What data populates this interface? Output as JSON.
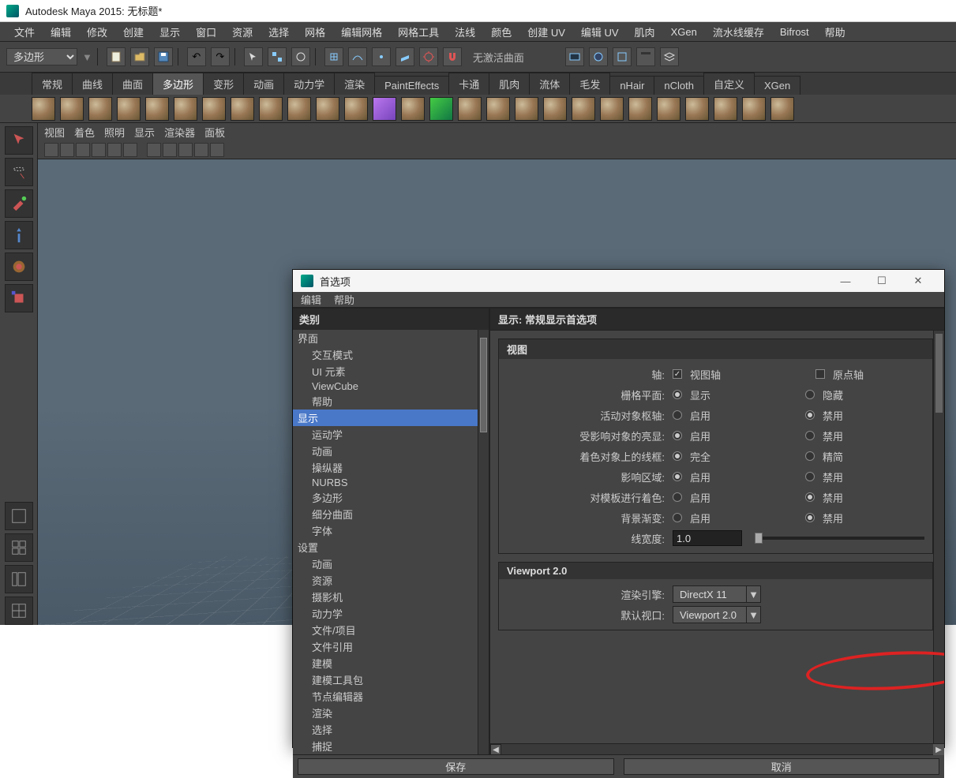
{
  "window": {
    "title": "Autodesk Maya 2015: 无标题*"
  },
  "menubar": [
    "文件",
    "编辑",
    "修改",
    "创建",
    "显示",
    "窗口",
    "资源",
    "选择",
    "网格",
    "编辑网格",
    "网格工具",
    "法线",
    "颜色",
    "创建 UV",
    "编辑 UV",
    "肌肉",
    "XGen",
    "流水线缓存",
    "Bifrost",
    "帮助"
  ],
  "mode_select": "多边形",
  "no_active_surface": "无激活曲面",
  "shelf_tabs": [
    "常规",
    "曲线",
    "曲面",
    "多边形",
    "变形",
    "动画",
    "动力学",
    "渲染",
    "PaintEffects",
    "卡通",
    "肌肉",
    "流体",
    "毛发",
    "nHair",
    "nCloth",
    "自定义",
    "XGen"
  ],
  "shelf_tab_active": 3,
  "vp_toolbar": [
    "视图",
    "着色",
    "照明",
    "显示",
    "渲染器",
    "面板"
  ],
  "dialog": {
    "title": "首选项",
    "menu": [
      "编辑",
      "帮助"
    ],
    "category_label": "类别",
    "categories": [
      {
        "txt": "界面",
        "lvl": "h"
      },
      {
        "txt": "交互模式",
        "lvl": "s"
      },
      {
        "txt": "UI 元素",
        "lvl": "s"
      },
      {
        "txt": "ViewCube",
        "lvl": "s"
      },
      {
        "txt": "帮助",
        "lvl": "s"
      },
      {
        "txt": "显示",
        "lvl": "h",
        "sel": true
      },
      {
        "txt": "运动学",
        "lvl": "s"
      },
      {
        "txt": "动画",
        "lvl": "s"
      },
      {
        "txt": "操纵器",
        "lvl": "s"
      },
      {
        "txt": "NURBS",
        "lvl": "s"
      },
      {
        "txt": "多边形",
        "lvl": "s"
      },
      {
        "txt": "细分曲面",
        "lvl": "s"
      },
      {
        "txt": "字体",
        "lvl": "s"
      },
      {
        "txt": "设置",
        "lvl": "h"
      },
      {
        "txt": "动画",
        "lvl": "s"
      },
      {
        "txt": "资源",
        "lvl": "s"
      },
      {
        "txt": "摄影机",
        "lvl": "s"
      },
      {
        "txt": "动力学",
        "lvl": "s"
      },
      {
        "txt": "文件/项目",
        "lvl": "s"
      },
      {
        "txt": "文件引用",
        "lvl": "s"
      },
      {
        "txt": "建模",
        "lvl": "s"
      },
      {
        "txt": "建模工具包",
        "lvl": "s"
      },
      {
        "txt": "节点编辑器",
        "lvl": "s"
      },
      {
        "txt": "渲染",
        "lvl": "s"
      },
      {
        "txt": "选择",
        "lvl": "s"
      },
      {
        "txt": "捕捉",
        "lvl": "s"
      }
    ],
    "right_header": "显示: 常规显示首选项",
    "section_view": "视图",
    "rows": {
      "axis_lbl": "轴:",
      "axis_chk": "视图轴",
      "axis_chk2": "原点轴",
      "grid_lbl": "栅格平面:",
      "grid_a": "显示",
      "grid_b": "隐藏",
      "pivot_lbl": "活动对象枢轴:",
      "pivot_a": "启用",
      "pivot_b": "禁用",
      "affect_lbl": "受影响对象的亮显:",
      "affect_a": "启用",
      "affect_b": "禁用",
      "wire_lbl": "着色对象上的线框:",
      "wire_a": "完全",
      "wire_b": "精简",
      "region_lbl": "影响区域:",
      "region_a": "启用",
      "region_b": "禁用",
      "template_lbl": "对模板进行着色:",
      "template_a": "启用",
      "template_b": "禁用",
      "bg_lbl": "背景渐变:",
      "bg_a": "启用",
      "bg_b": "禁用",
      "linew_lbl": "线宽度:",
      "linew_val": "1.0"
    },
    "section_vp20": "Viewport 2.0",
    "engine_lbl": "渲染引擎:",
    "engine_val": "DirectX 11",
    "defvp_lbl": "默认视口:",
    "defvp_val": "Viewport 2.0",
    "save_btn": "保存",
    "cancel_btn": "取消"
  }
}
